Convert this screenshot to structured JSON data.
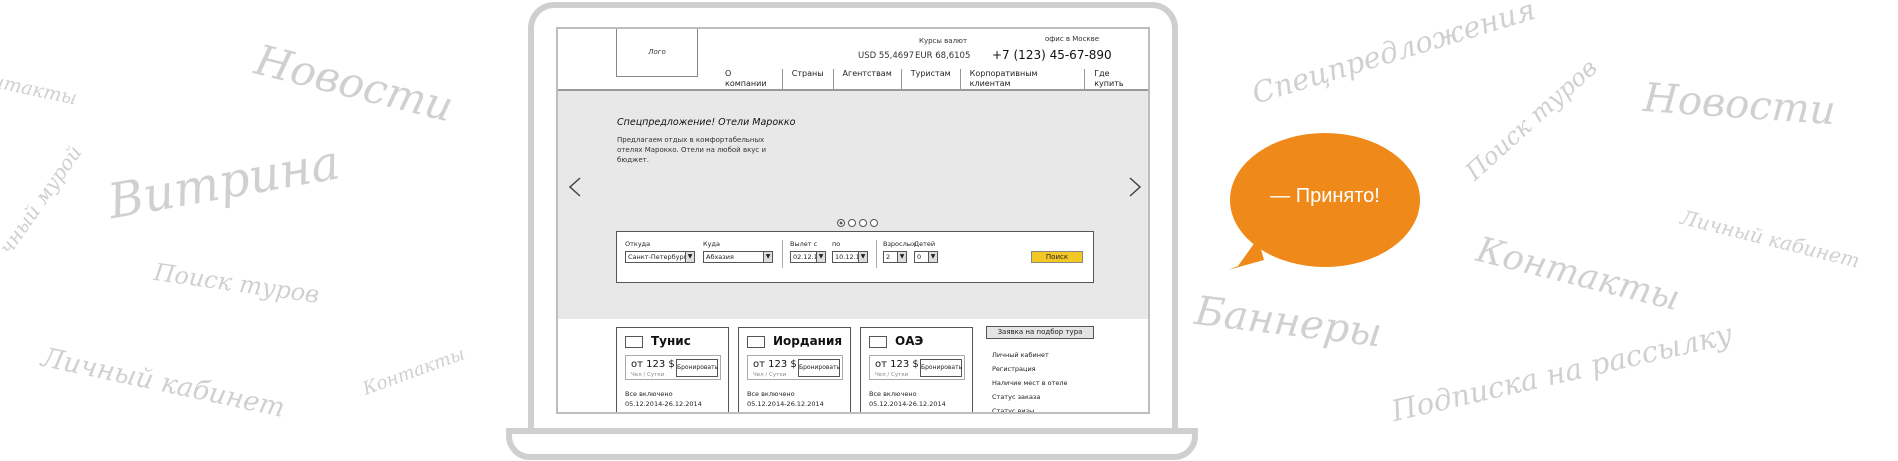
{
  "background_words": [
    "нтакты",
    "Новости",
    "Витрина",
    "чный мурой",
    "Поиск туров",
    "Личный кабинет",
    "Контакты",
    "Спецпредложения",
    "Поиск туров",
    "Новости",
    "Личный кабинет",
    "Контакты",
    "Баннеры",
    "Подписка на рассылку"
  ],
  "header": {
    "logo": "Лого",
    "rates_title": "Курсы валют",
    "usd": "USD 55,4697",
    "eur": "EUR 68,6105",
    "office": "офис в Москве",
    "phone": "+7 (123) 45-67-890"
  },
  "nav": [
    "О компании",
    "Страны",
    "Агентствам",
    "Туристам",
    "Корпоративным клиентам",
    "Где купить"
  ],
  "banner": {
    "title": "Спецпредложение! Отели Марокко",
    "text": "Предлагаем отдых в комфортабельных отелях Марокко. Отели на любой вкус и бюджет.",
    "prev_icon": "chevron-left-icon",
    "next_icon": "chevron-right-icon",
    "slides": 4,
    "active_slide": 1
  },
  "search": {
    "from_label": "Откуда",
    "from_value": "Санкт-Петербург",
    "to_label": "Куда",
    "to_value": "Абхазия",
    "depart_label": "Вылет с",
    "depart_value": "02.12.14",
    "until_label": "по",
    "until_value": "10.12.14",
    "adults_label": "Взрослых",
    "adults_value": "2",
    "children_label": "Детей",
    "children_value": "0",
    "button": "Поиск"
  },
  "cards": [
    {
      "title": "Тунис",
      "price": "от 123 $",
      "per": "Чел / Сутки",
      "book": "Бронировать",
      "incl": "Все включено",
      "dates": "05.12.2014-26.12.2014"
    },
    {
      "title": "Иордания",
      "price": "от 123 $",
      "per": "Чел / Сутки",
      "book": "Бронировать",
      "incl": "Все включено",
      "dates": "05.12.2014-26.12.2014"
    },
    {
      "title": "ОАЭ",
      "price": "от 123 $",
      "per": "Чел / Сутки",
      "book": "Бронировать",
      "incl": "Все включено",
      "dates": "05.12.2014-26.12.2014"
    }
  ],
  "sidebar": {
    "button": "Заявка на подбор тура",
    "links": [
      "Личный кабинет",
      "Регистрация",
      "Наличие мест в отеле",
      "Статус заказа",
      "Статус визы"
    ]
  },
  "bubble": {
    "text": "— Принято!"
  },
  "colors": {
    "accent": "#ef8a1a",
    "search_button": "#f3c825",
    "banner_bg": "#e8e8e8"
  }
}
